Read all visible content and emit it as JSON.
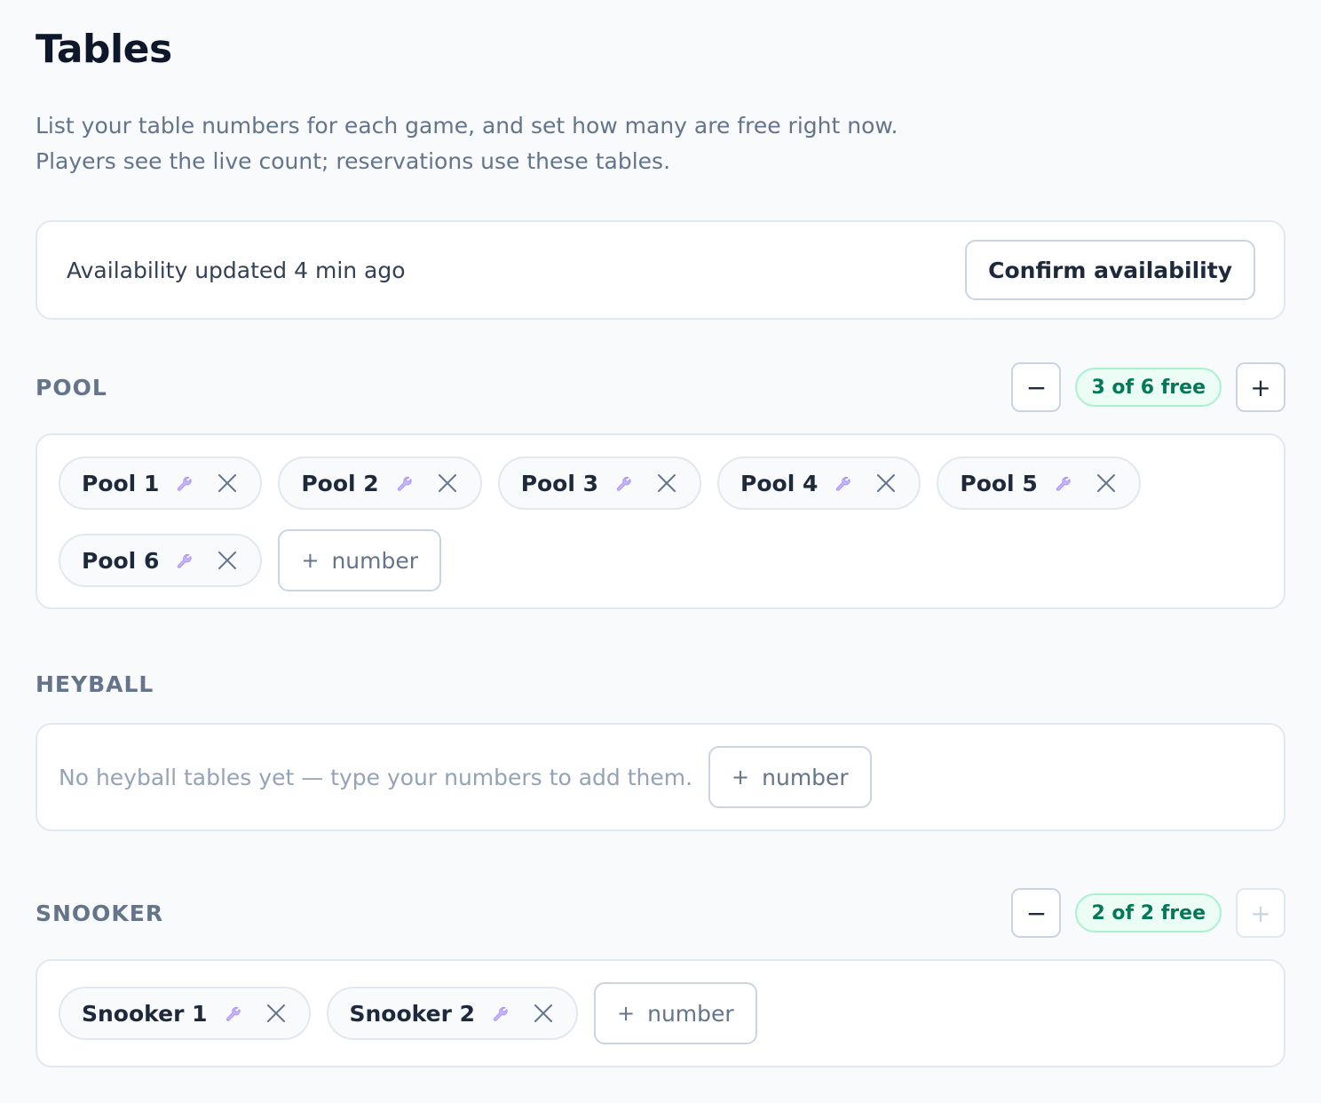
{
  "page": {
    "title": "Tables",
    "intro_line1": "List your table numbers for each game, and set how many are free right now.",
    "intro_line2": "Players see the live count; reservations use these tables."
  },
  "status": {
    "text": "Availability updated 4 min ago",
    "confirm_label": "Confirm availability"
  },
  "controls": {
    "decrement_symbol": "−",
    "increment_symbol": "+",
    "add_symbol": "+",
    "add_label": "number"
  },
  "sections": {
    "pool": {
      "label": "POOL",
      "free_count": 3,
      "total_count": 6,
      "badge": "3 of 6 free",
      "tables": [
        "Pool 1",
        "Pool 2",
        "Pool 3",
        "Pool 4",
        "Pool 5",
        "Pool 6"
      ]
    },
    "heyball": {
      "label": "HEYBALL",
      "empty_text": "No heyball tables yet — type your numbers to add them.",
      "tables": []
    },
    "snooker": {
      "label": "SNOOKER",
      "free_count": 2,
      "total_count": 2,
      "badge": "2 of 2 free",
      "increment_disabled": true,
      "tables": [
        "Snooker 1",
        "Snooker 2"
      ]
    }
  },
  "icons": {
    "chip_tool": "wrench-icon",
    "chip_remove": "close-icon"
  },
  "colors": {
    "free_badge_bg": "#ecfdf5",
    "free_badge_border": "#a7f3d0",
    "free_badge_text": "#047857",
    "wrench": "#c4b5fd",
    "border": "#e2e8f0"
  }
}
